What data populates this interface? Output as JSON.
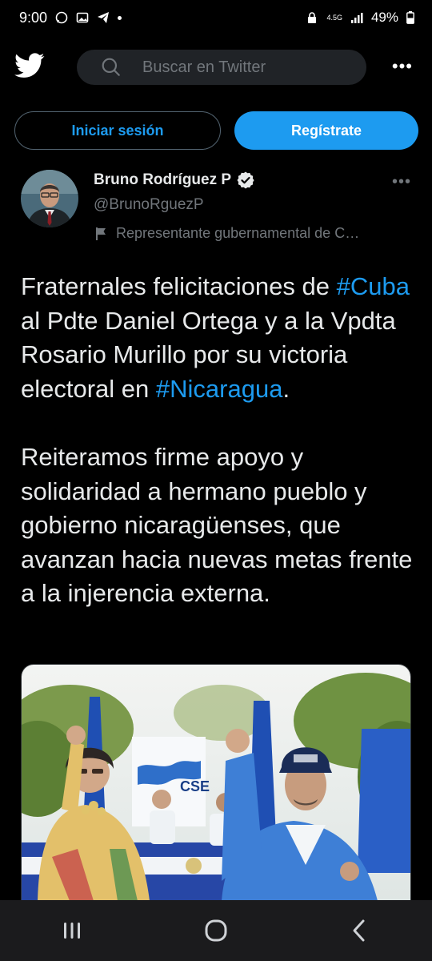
{
  "status_bar": {
    "time": "9:00",
    "network": "4.5G",
    "battery": "49%"
  },
  "header": {
    "logo_icon": "twitter-bird-icon",
    "search_placeholder": "Buscar en Twitter",
    "more_label": "•••"
  },
  "auth": {
    "login_label": "Iniciar sesión",
    "signup_label": "Regístrate"
  },
  "tweet": {
    "author_name": "Bruno Rodríguez P",
    "handle": "@BrunoRguezP",
    "more_label": "•••",
    "gov_label": "Representante gubernamental de C…",
    "p1_a": "Fraternales felicitaciones de ",
    "hashtag_cuba": "#Cuba",
    "p1_b": " al Pdte Daniel Ortega y a la Vpdta Rosario Murillo por su victoria electoral en ",
    "hashtag_nicaragua": "#Nicaragua",
    "p1_c": ".",
    "p2": "Reiteramos firme apoyo y solidaridad a hermano pueblo y gobierno nicaragüenses, que avanzan hacia nuevas metas frente a la injerencia externa.",
    "photo_sign_text": "CSE"
  },
  "colors": {
    "accent": "#1d9bf0",
    "background": "#000000",
    "muted_text": "#71767b"
  }
}
